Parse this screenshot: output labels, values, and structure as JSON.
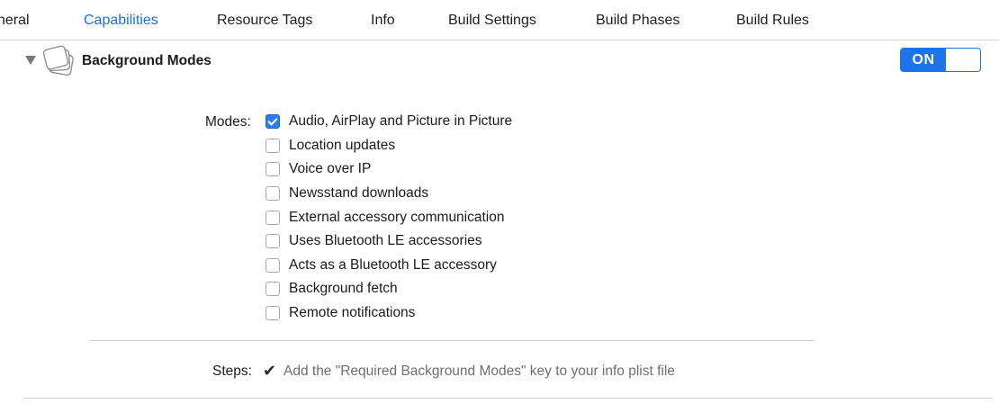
{
  "tabs": [
    {
      "label": "neral",
      "active": false
    },
    {
      "label": "Capabilities",
      "active": true
    },
    {
      "label": "Resource Tags",
      "active": false
    },
    {
      "label": "Info",
      "active": false
    },
    {
      "label": "Build Settings",
      "active": false
    },
    {
      "label": "Build Phases",
      "active": false
    },
    {
      "label": "Build Rules",
      "active": false
    }
  ],
  "capability": {
    "title": "Background Modes",
    "icon": "stacked-pages-icon",
    "toggle_label": "ON",
    "toggle_state": "on"
  },
  "modes": {
    "label": "Modes:",
    "items": [
      {
        "label": "Audio, AirPlay and Picture in Picture",
        "checked": true
      },
      {
        "label": "Location updates",
        "checked": false
      },
      {
        "label": "Voice over IP",
        "checked": false
      },
      {
        "label": "Newsstand downloads",
        "checked": false
      },
      {
        "label": "External accessory communication",
        "checked": false
      },
      {
        "label": "Uses Bluetooth LE accessories",
        "checked": false
      },
      {
        "label": "Acts as a Bluetooth LE accessory",
        "checked": false
      },
      {
        "label": "Background fetch",
        "checked": false
      },
      {
        "label": "Remote notifications",
        "checked": false
      }
    ]
  },
  "steps": {
    "label": "Steps:",
    "check_glyph": "✔",
    "items": [
      {
        "text": "Add the \"Required Background Modes\" key to your info plist file",
        "done": true
      }
    ]
  },
  "colors": {
    "accent": "#1d73e8",
    "active_tab": "#1d6fe0",
    "muted_text": "#6e6e6e"
  }
}
